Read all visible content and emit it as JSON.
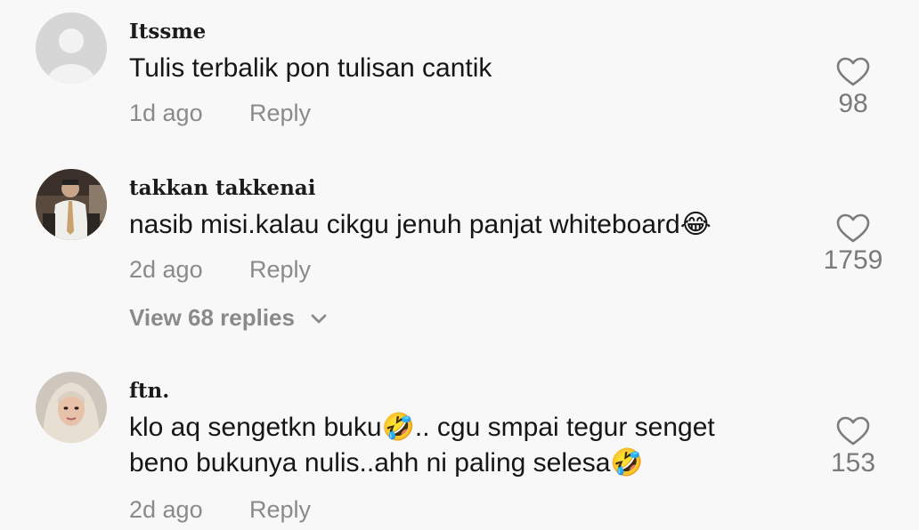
{
  "comments": [
    {
      "username": "Itssme",
      "text_lines": [
        "Tulis terbalik pon tulisan cantik"
      ],
      "time": "1d ago",
      "reply": "Reply",
      "likes": "98"
    },
    {
      "username": "takkan takkenai",
      "text_lines": [
        "nasib misi.kalau cikgu jenuh panjat whiteboard😂"
      ],
      "time": "2d ago",
      "reply": "Reply",
      "likes": "1759",
      "view_replies": "View 68 replies"
    },
    {
      "username": "ftn.",
      "text_lines": [
        "klo aq sengetkn buku🤣.. cgu smpai tegur senget",
        "beno bukunya nulis..ahh ni paling selesa🤣"
      ],
      "time": "2d ago",
      "reply": "Reply",
      "likes": "153"
    }
  ],
  "icons": {
    "like": "heart-outline-icon",
    "expand": "chevron-down-icon",
    "default_avatar": "user-silhouette-icon"
  },
  "colors": {
    "background": "#f8f8f8",
    "username": "#1b1b1b",
    "text": "#161616",
    "muted": "#8a8a8a"
  }
}
